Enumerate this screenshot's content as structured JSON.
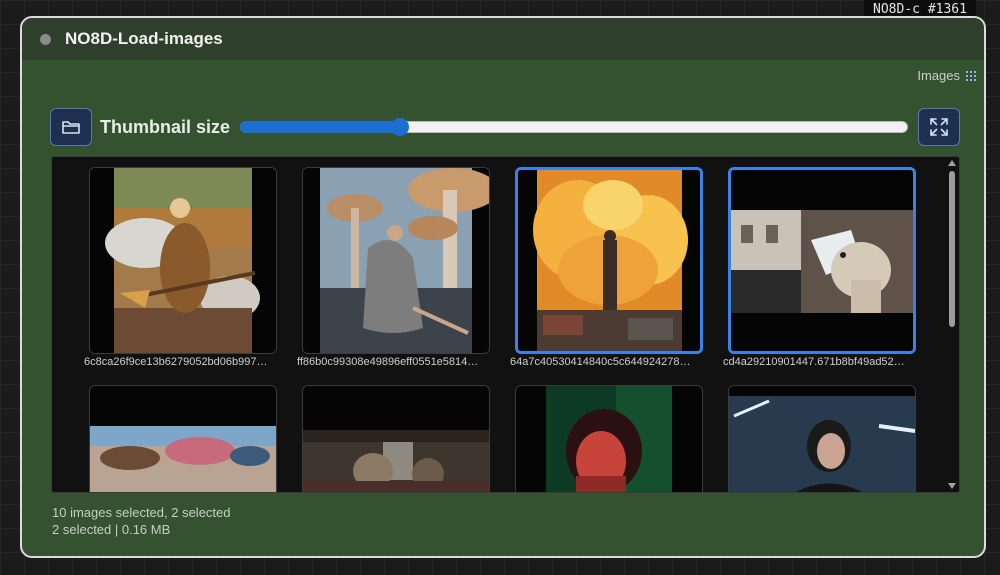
{
  "node": {
    "badge": "NO8D-c  #1361",
    "title": "NO8D-Load-images",
    "widget_label": "Images",
    "status_dot_color": "#8a8a8a"
  },
  "toolbar": {
    "open_folder_icon": "folder-icon",
    "thumbnail_label": "Thumbnail size",
    "thumbnail_size_fraction": 0.24,
    "expand_icon": "expand-arrows-icon"
  },
  "gallery": {
    "images": [
      {
        "caption": "6c8ca26f9ce13b6279052bd06b997…",
        "selected": false,
        "subject": "woman-on-broomstick"
      },
      {
        "caption": "ff86b0c99308e49896eff0551e5814…",
        "selected": false,
        "subject": "woman-under-giant-mushrooms"
      },
      {
        "caption": "64a7c40530414840c5c644924278…",
        "selected": true,
        "subject": "figure-before-explosion"
      },
      {
        "caption": "cd4a29210901447.671b8bf49ad52…",
        "selected": true,
        "subject": "dog-with-cone"
      },
      {
        "caption": "",
        "selected": false,
        "subject": "people-lying-outdoors"
      },
      {
        "caption": "",
        "selected": false,
        "subject": "library-scene"
      },
      {
        "caption": "",
        "selected": false,
        "subject": "woman-red-green-light"
      },
      {
        "caption": "",
        "selected": false,
        "subject": "woman-dark-hair-blue-room"
      }
    ]
  },
  "status": {
    "line1": "10 images selected, 2 selected",
    "line2": "2 selected | 0.16 MB"
  },
  "colors": {
    "node_body": "#345230",
    "node_header": "#2e3f2b",
    "accent": "#3b82e6",
    "slider": "#1c6fd1"
  }
}
